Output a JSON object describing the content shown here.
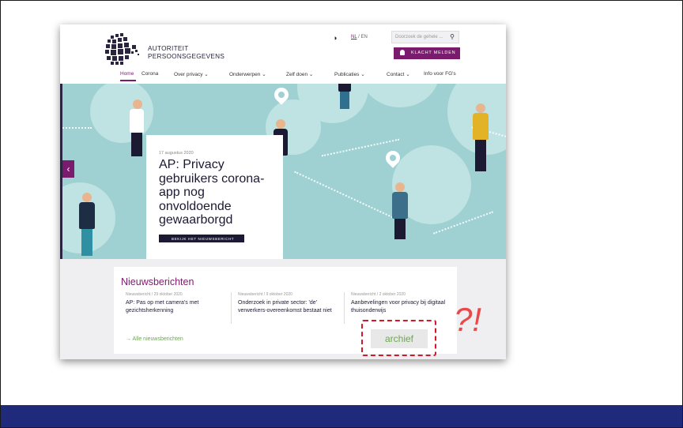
{
  "header": {
    "brand_line1": "AUTORITEIT",
    "brand_line2": "PERSOONSGEGEVENS",
    "contrast_icon": "contrast-icon",
    "lang_nl": "NL",
    "lang_sep": " / ",
    "lang_en": "EN",
    "search_placeholder": "Doorzoek de gehele ...",
    "complaint_button": "KLACHT MELDEN"
  },
  "nav": {
    "items": [
      "Home",
      "Corona",
      "Over privacy ⌄",
      "Onderwerpen ⌄",
      "Zelf doen ⌄",
      "Publicaties ⌄",
      "Contact ⌄",
      "Info voor FG's"
    ],
    "active": "Home"
  },
  "hero": {
    "date": "17 augustus 2020",
    "title": "AP: Privacy gebruikers corona-app nog onvoldoende gewaarborgd",
    "button": "BEKIJK HET NIEUWSBERICHT",
    "prev_arrow": "‹"
  },
  "news": {
    "title": "Nieuwsberichten",
    "items": [
      {
        "meta": "Nieuwsbericht / 29 oktober 2020",
        "headline": "AP: Pas op met camera's met gezichtsherkenning"
      },
      {
        "meta": "Nieuwsbericht / 9 oktober 2020",
        "headline": "Onderzoek in private sector: 'de' verwerkers-overeenkomst bestaat niet"
      },
      {
        "meta": "Nieuwsbericht / 2 oktober 2020",
        "headline": "Aanbevelingen voor privacy bij digitaal thuisonderwijs"
      }
    ],
    "all_link": "→  Alle nieuwsberichten"
  },
  "annotation": {
    "archive_label": "archief",
    "marks": "?!"
  },
  "colors": {
    "brand_purple": "#7a1b6d",
    "hero_teal": "#9fd1d3",
    "annotation_red": "#d0192b",
    "bottom_bar": "#1f2a7a"
  }
}
